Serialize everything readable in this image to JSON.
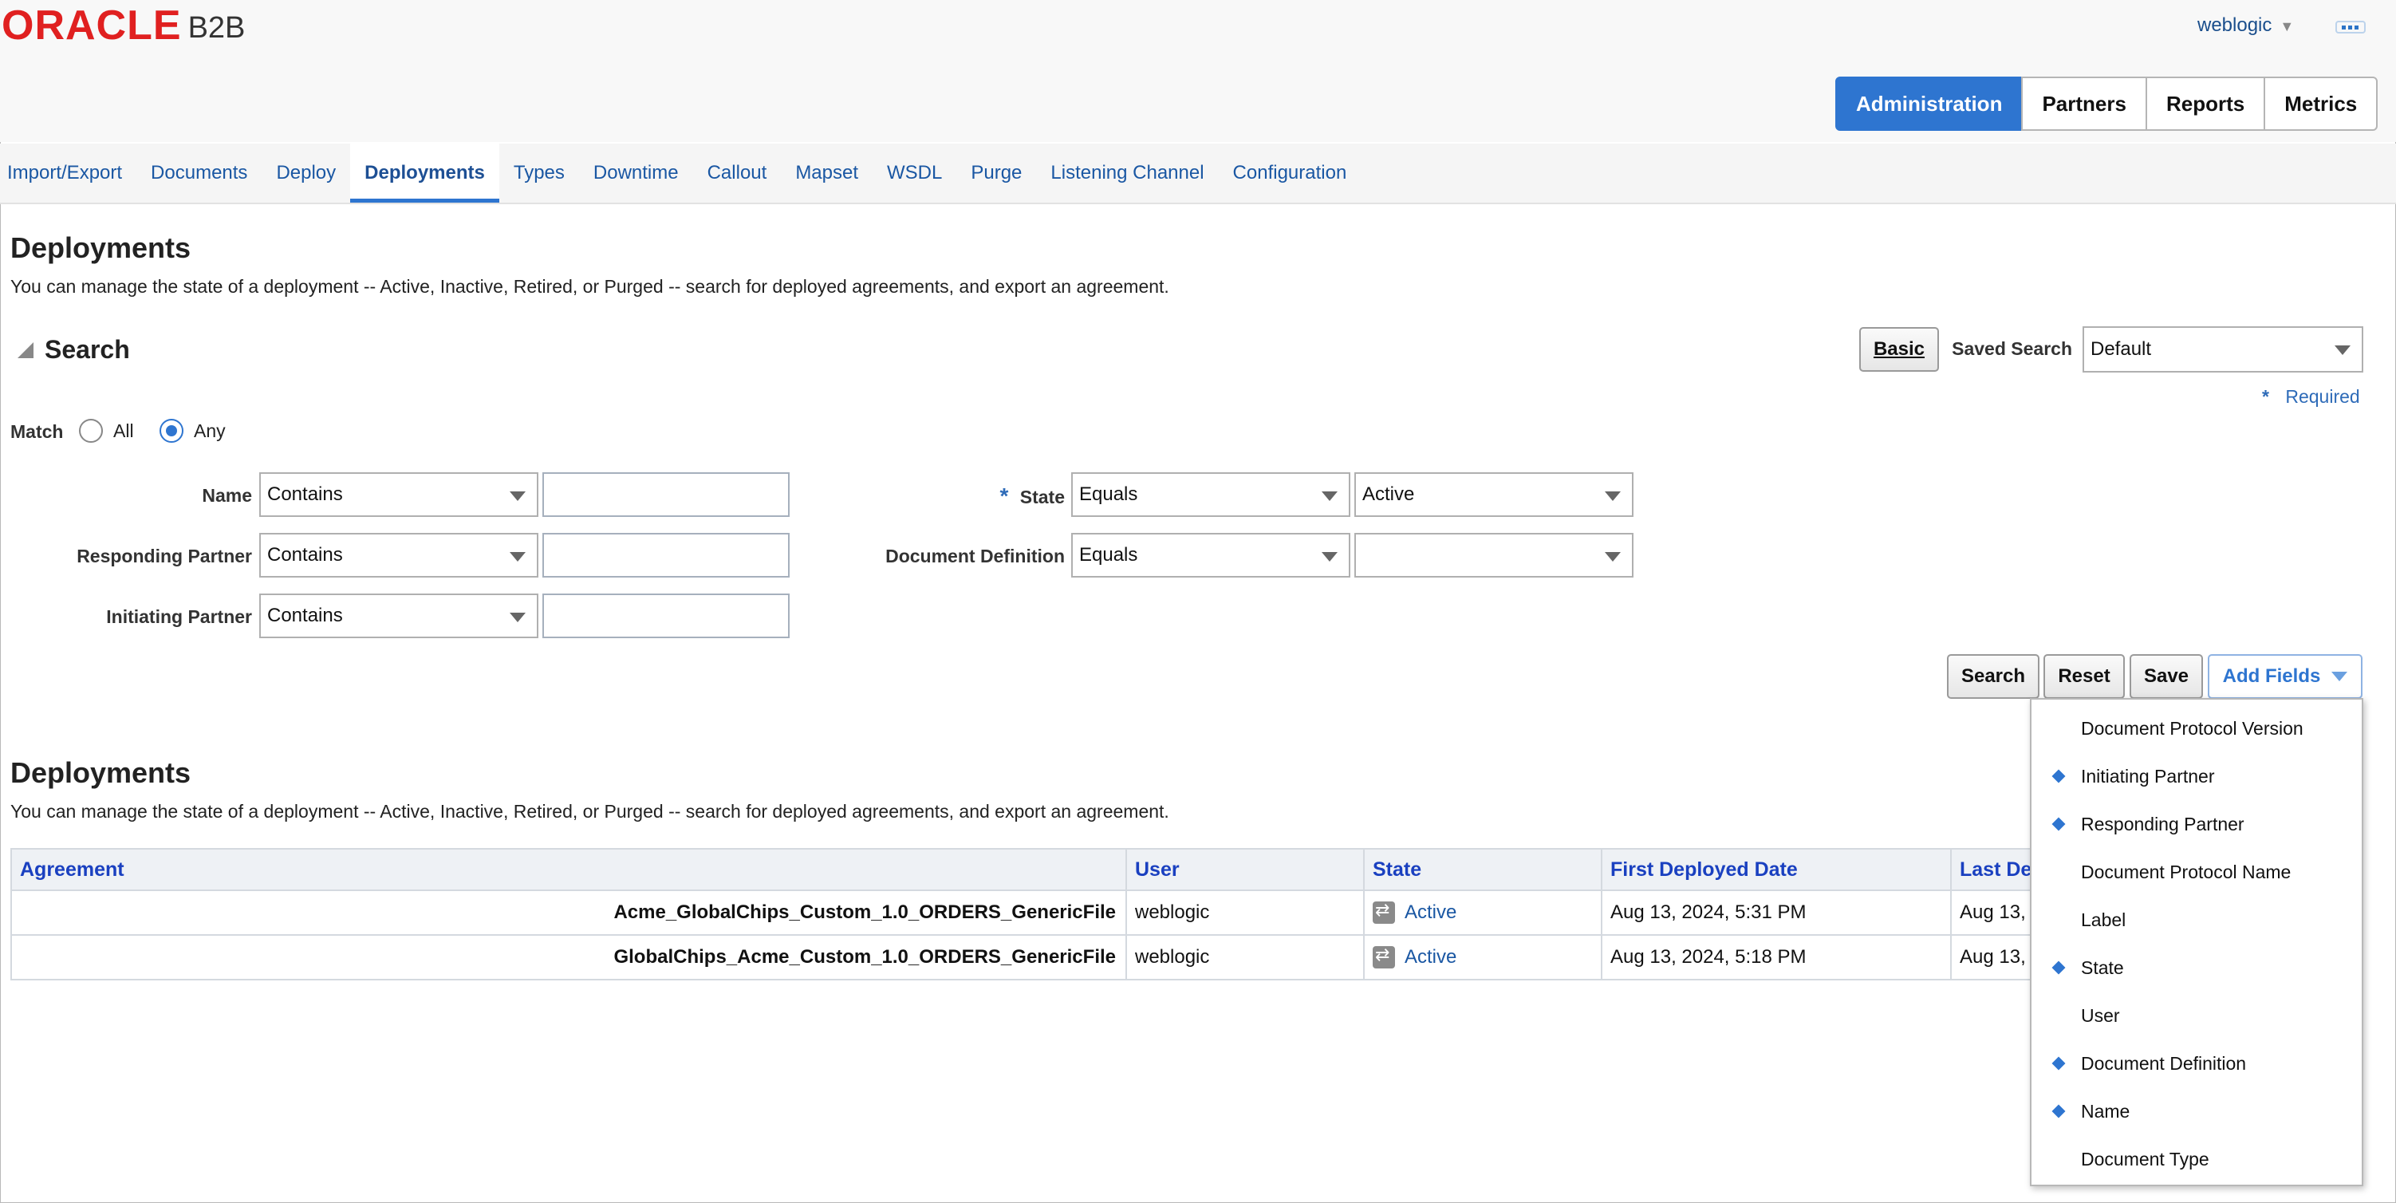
{
  "header": {
    "logo_oracle": "ORACLE",
    "logo_product": "B2B",
    "user": "weblogic",
    "main_tabs": [
      {
        "label": "Administration",
        "active": true
      },
      {
        "label": "Partners",
        "active": false
      },
      {
        "label": "Reports",
        "active": false
      },
      {
        "label": "Metrics",
        "active": false
      }
    ]
  },
  "sub_nav": [
    {
      "label": "Import/Export"
    },
    {
      "label": "Documents"
    },
    {
      "label": "Deploy"
    },
    {
      "label": "Deployments",
      "active": true
    },
    {
      "label": "Types"
    },
    {
      "label": "Downtime"
    },
    {
      "label": "Callout"
    },
    {
      "label": "Mapset"
    },
    {
      "label": "WSDL"
    },
    {
      "label": "Purge"
    },
    {
      "label": "Listening Channel"
    },
    {
      "label": "Configuration"
    }
  ],
  "page": {
    "title": "Deployments",
    "description": "You can manage the state of a deployment -- Active, Inactive, Retired, or Purged -- search for deployed agreements, and export an agreement."
  },
  "search": {
    "title": "Search",
    "basic_button": "Basic",
    "saved_search_label": "Saved Search",
    "saved_search_value": "Default",
    "required_star": "*",
    "required_label": "Required",
    "match_label": "Match",
    "match_all": "All",
    "match_any": "Any",
    "match_selected": "Any",
    "fields": {
      "name": {
        "label": "Name",
        "operator": "Contains",
        "value": ""
      },
      "responding_partner": {
        "label": "Responding Partner",
        "operator": "Contains",
        "value": ""
      },
      "initiating_partner": {
        "label": "Initiating Partner",
        "operator": "Contains",
        "value": ""
      },
      "state": {
        "label": "State",
        "required": "*",
        "operator": "Equals",
        "value": "Active"
      },
      "document_definition": {
        "label": "Document Definition",
        "operator": "Equals",
        "value": ""
      }
    },
    "buttons": {
      "search": "Search",
      "reset": "Reset",
      "save": "Save",
      "add_fields": "Add Fields"
    }
  },
  "results": {
    "title": "Deployments",
    "description": "You can manage the state of a deployment -- Active, Inactive, Retired, or Purged -- search for deployed agreements, and export an agreement.",
    "columns": [
      "Agreement",
      "User",
      "State",
      "First Deployed Date",
      "Last De"
    ],
    "rows": [
      {
        "agreement": "Acme_GlobalChips_Custom_1.0_ORDERS_GenericFile",
        "user": "weblogic",
        "state": "Active",
        "first_deployed": "Aug 13, 2024, 5:31 PM",
        "last_deployed": "Aug 13, 2"
      },
      {
        "agreement": "GlobalChips_Acme_Custom_1.0_ORDERS_GenericFile",
        "user": "weblogic",
        "state": "Active",
        "first_deployed": "Aug 13, 2024, 5:18 PM",
        "last_deployed": "Aug 13, 2"
      }
    ]
  },
  "add_fields_menu": [
    {
      "label": "Document Protocol Version",
      "selected": false
    },
    {
      "label": "Initiating Partner",
      "selected": true
    },
    {
      "label": "Responding Partner",
      "selected": true
    },
    {
      "label": "Document Protocol Name",
      "selected": false
    },
    {
      "label": "Label",
      "selected": false
    },
    {
      "label": "State",
      "selected": true
    },
    {
      "label": "User",
      "selected": false
    },
    {
      "label": "Document Definition",
      "selected": true
    },
    {
      "label": "Name",
      "selected": true
    },
    {
      "label": "Document Type",
      "selected": false
    }
  ],
  "colors": {
    "accent": "#2e75d0",
    "link": "#1a57a3",
    "brand_red": "#e02020"
  }
}
